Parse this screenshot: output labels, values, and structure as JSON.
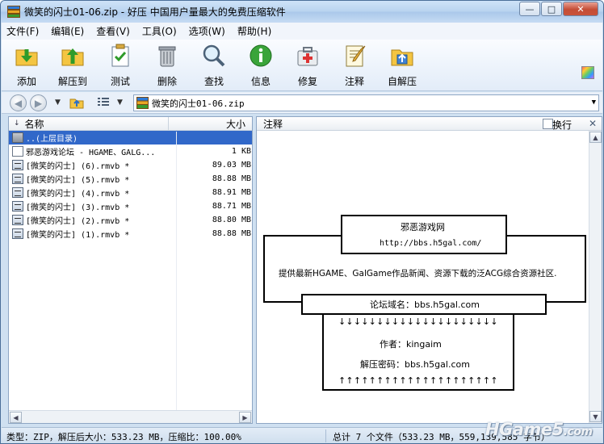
{
  "window": {
    "title": "微笑的闪士01-06.zip - 好压 中国用户量最大的免费压缩软件"
  },
  "window_buttons": {
    "minimize": "—",
    "maximize": "□",
    "close": "✕"
  },
  "menu": [
    "文件(F)",
    "编辑(E)",
    "查看(V)",
    "工具(O)",
    "选项(W)",
    "帮助(H)"
  ],
  "toolbar": [
    {
      "label": "添加",
      "icon": "add-icon"
    },
    {
      "label": "解压到",
      "icon": "extract-icon"
    },
    {
      "label": "测试",
      "icon": "test-icon"
    },
    {
      "label": "删除",
      "icon": "trash-icon"
    },
    {
      "label": "查找",
      "icon": "magnifier-icon"
    },
    {
      "label": "信息",
      "icon": "info-icon"
    },
    {
      "label": "修复",
      "icon": "repair-icon"
    },
    {
      "label": "注释",
      "icon": "comment-icon"
    },
    {
      "label": "自解压",
      "icon": "sfx-icon"
    }
  ],
  "address": {
    "path": "微笑的闪士01-06.zip"
  },
  "file_list": {
    "col_name": "名称",
    "col_size": "大小",
    "rows": [
      {
        "name": "..(上层目录)",
        "size": "",
        "type": "up",
        "selected": true
      },
      {
        "name": "邪恶游戏论坛 - HGAME、GALG...",
        "size": "1 KB",
        "type": "txt",
        "selected": false
      },
      {
        "name": "[微笑的闪士] (6).rmvb *",
        "size": "89.03 MB",
        "type": "video",
        "selected": false
      },
      {
        "name": "[微笑的闪士] (5).rmvb *",
        "size": "88.88 MB",
        "type": "video",
        "selected": false
      },
      {
        "name": "[微笑的闪士] (4).rmvb *",
        "size": "88.91 MB",
        "type": "video",
        "selected": false
      },
      {
        "name": "[微笑的闪士] (3).rmvb *",
        "size": "88.71 MB",
        "type": "video",
        "selected": false
      },
      {
        "name": "[微笑的闪士] (2).rmvb *",
        "size": "88.80 MB",
        "type": "video",
        "selected": false
      },
      {
        "name": "[微笑的闪士] (1).rmvb *",
        "size": "88.88 MB",
        "type": "video",
        "selected": false
      }
    ]
  },
  "comment_pane": {
    "title": "注释",
    "wrap_label": "换行",
    "close": "✕",
    "site_name": "邪恶游戏网",
    "site_url": "http://bbs.h5gal.com/",
    "description": "提供最新HGAME、GalGame作品新闻、资源下载的泛ACG综合资源社区.",
    "domain_line": "论坛域名：bbs.h5gal.com",
    "arrows_down": "↓↓↓↓↓↓↓↓↓↓↓↓↓↓↓↓↓↓↓↓↓",
    "author_line": "作者：kingaim",
    "password_line": "解压密码：bbs.h5gal.com",
    "arrows_up": "↑↑↑↑↑↑↑↑↑↑↑↑↑↑↑↑↑↑↑↑↑"
  },
  "status": {
    "left": "类型：ZIP，解压后大小：533.23 MB，压缩比：100.00%",
    "right": "总计 7 个文件（533.23 MB，559,139,585 字节）"
  },
  "watermark": {
    "main": "HGame5",
    "suffix": ".com"
  }
}
